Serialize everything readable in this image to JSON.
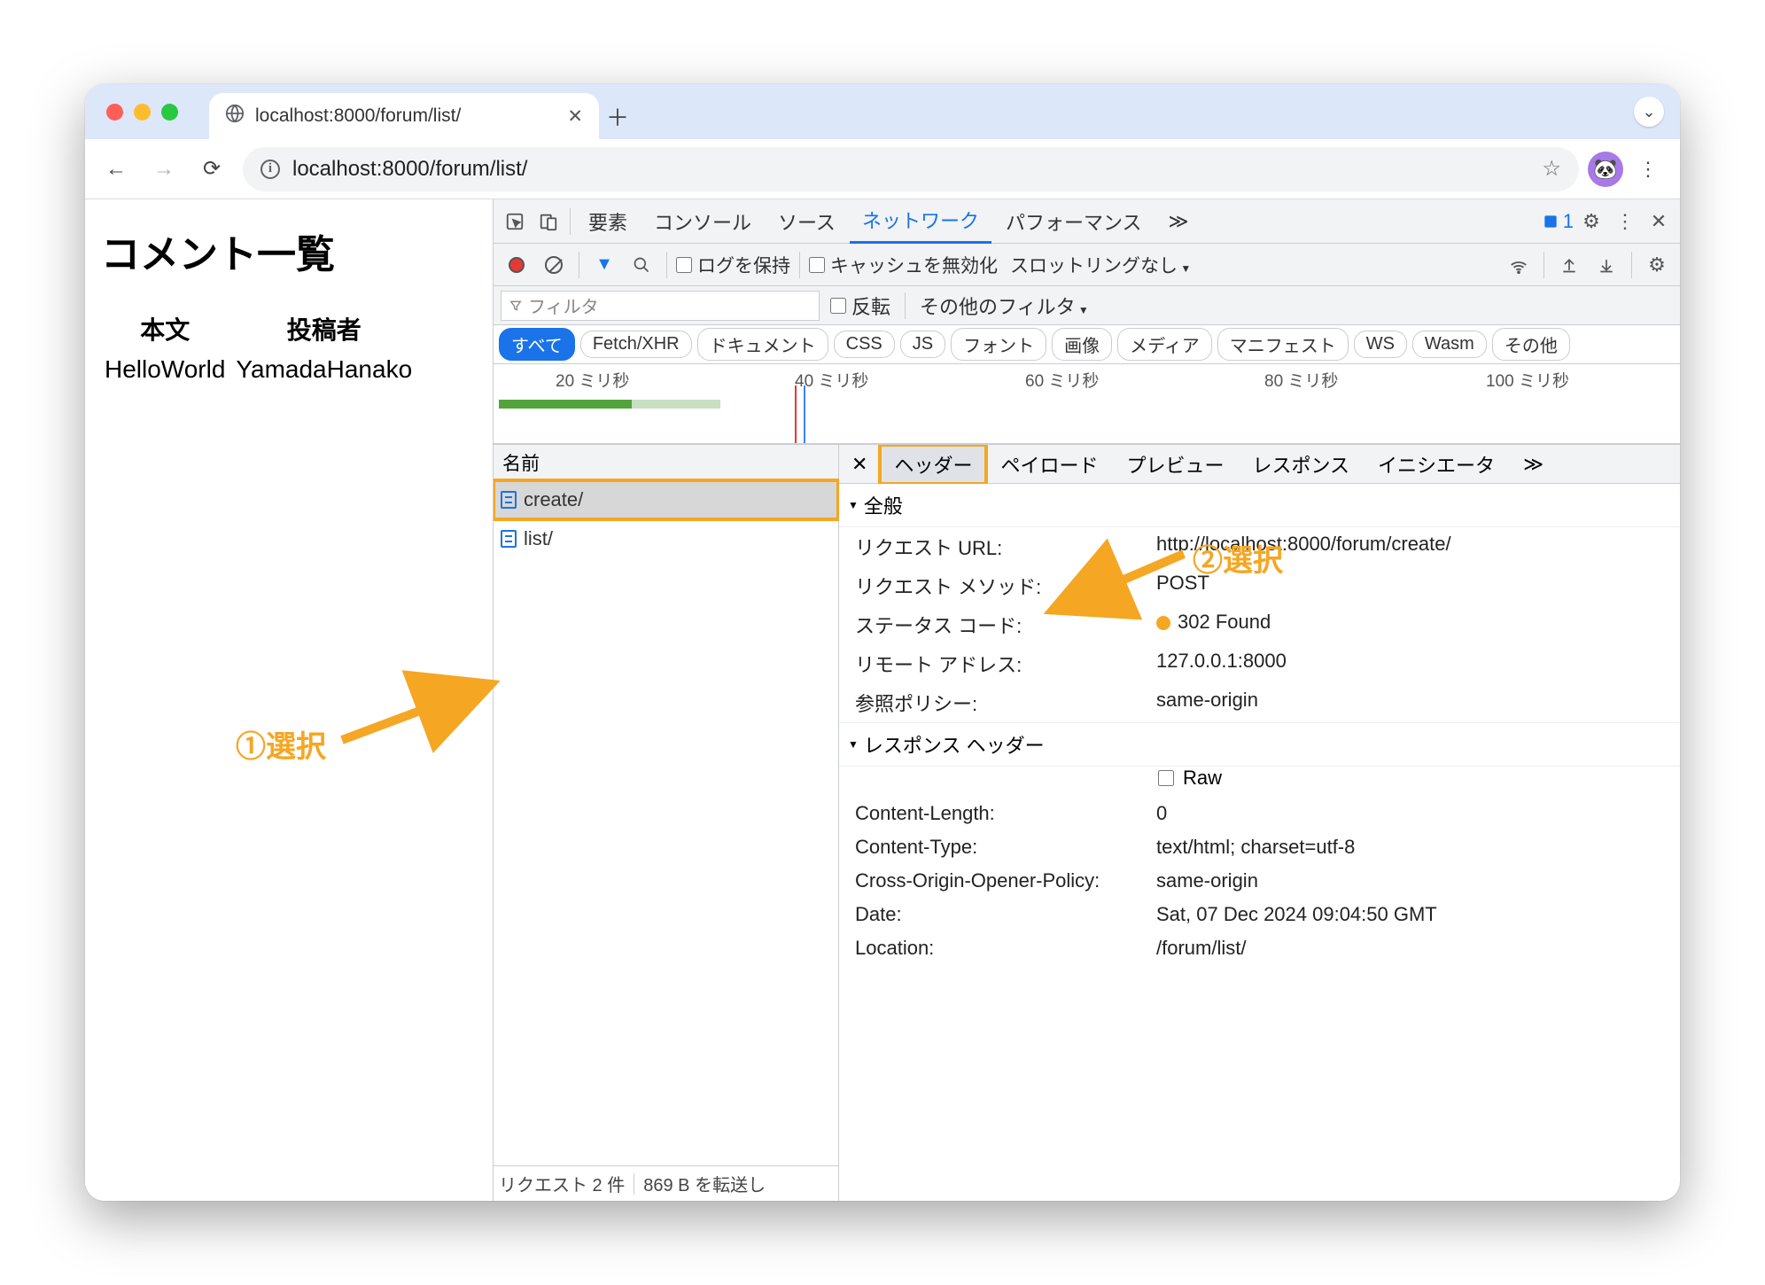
{
  "window": {
    "tab_title": "localhost:8000/forum/list/",
    "url": "localhost:8000/forum/list/"
  },
  "page": {
    "heading": "コメント一覧",
    "col_body": "本文",
    "col_author": "投稿者",
    "row_body": "HelloWorld",
    "row_author": "YamadaHanako"
  },
  "devtools": {
    "tabs": {
      "elements": "要素",
      "console": "コンソール",
      "sources": "ソース",
      "network": "ネットワーク",
      "performance": "パフォーマンス",
      "more": "≫"
    },
    "issues_count": "1",
    "toolbar": {
      "preserve_log": "ログを保持",
      "disable_cache": "キャッシュを無効化",
      "throttling": "スロットリングなし"
    },
    "filter": {
      "placeholder": "フィルタ",
      "invert": "反転",
      "more": "その他のフィルタ"
    },
    "chips": {
      "all": "すべて",
      "fetch": "Fetch/XHR",
      "doc": "ドキュメント",
      "css": "CSS",
      "js": "JS",
      "font": "フォント",
      "img": "画像",
      "media": "メディア",
      "manifest": "マニフェスト",
      "ws": "WS",
      "wasm": "Wasm",
      "other": "その他"
    },
    "timeline": {
      "t20": "20 ミリ秒",
      "t40": "40 ミリ秒",
      "t60": "60 ミリ秒",
      "t80": "80 ミリ秒",
      "t100": "100 ミリ秒"
    },
    "panel": {
      "name_header": "名前",
      "req_create": "create/",
      "req_list": "list/",
      "status_requests": "リクエスト 2 件",
      "status_transferred": "869 B を転送し"
    },
    "detail": {
      "tab_headers": "ヘッダー",
      "tab_payload": "ペイロード",
      "tab_preview": "プレビュー",
      "tab_response": "レスポンス",
      "tab_initiator": "イニシエータ",
      "more": "≫",
      "general": "全般",
      "req_url_k": "リクエスト URL:",
      "req_url_v": "http://localhost:8000/forum/create/",
      "req_method_k": "リクエスト メソッド:",
      "req_method_v": "POST",
      "status_k": "ステータス コード:",
      "status_v": "302 Found",
      "remote_k": "リモート アドレス:",
      "remote_v": "127.0.0.1:8000",
      "refpol_k": "参照ポリシー:",
      "refpol_v": "same-origin",
      "resp_headers": "レスポンス ヘッダー",
      "raw": "Raw",
      "cl_k": "Content-Length:",
      "cl_v": "0",
      "ct_k": "Content-Type:",
      "ct_v": "text/html; charset=utf-8",
      "coop_k": "Cross-Origin-Opener-Policy:",
      "coop_v": "same-origin",
      "date_k": "Date:",
      "date_v": "Sat, 07 Dec 2024 09:04:50 GMT",
      "loc_k": "Location:",
      "loc_v": "/forum/list/"
    }
  },
  "annotations": {
    "a1": "①選択",
    "a2": "②選択"
  }
}
